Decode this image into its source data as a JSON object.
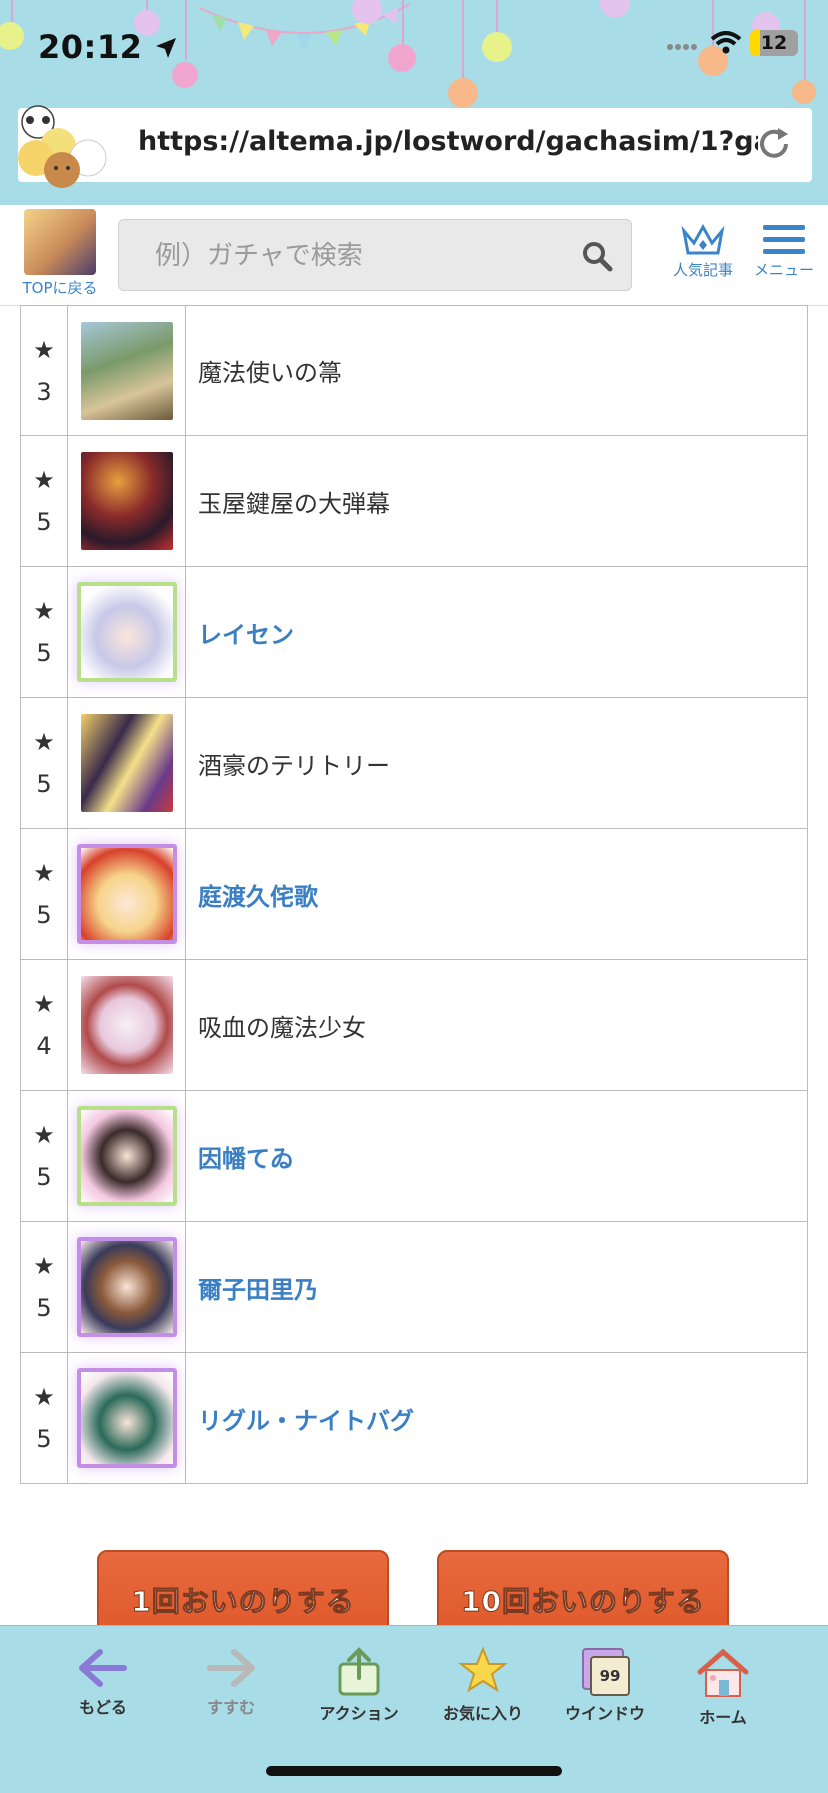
{
  "status_bar": {
    "time": "20:12",
    "battery": "12"
  },
  "browser": {
    "url": "https://altema.jp/lostword/gachasim/1?gac..."
  },
  "site_header": {
    "top_label": "TOPに戻る",
    "search_placeholder": "例）ガチャで検索",
    "popular_label": "人気記事",
    "menu_label": "メニュー"
  },
  "rows": [
    {
      "stars": "★",
      "rarity": "3",
      "name": "魔法使いの箒",
      "link": false
    },
    {
      "stars": "★",
      "rarity": "5",
      "name": "玉屋鍵屋の大弾幕",
      "link": false
    },
    {
      "stars": "★",
      "rarity": "5",
      "name": "レイセン",
      "link": true
    },
    {
      "stars": "★",
      "rarity": "5",
      "name": "酒豪のテリトリー",
      "link": false
    },
    {
      "stars": "★",
      "rarity": "5",
      "name": "庭渡久侘歌",
      "link": true
    },
    {
      "stars": "★",
      "rarity": "4",
      "name": "吸血の魔法少女",
      "link": false
    },
    {
      "stars": "★",
      "rarity": "5",
      "name": "因幡てゐ",
      "link": true
    },
    {
      "stars": "★",
      "rarity": "5",
      "name": "爾子田里乃",
      "link": true
    },
    {
      "stars": "★",
      "rarity": "5",
      "name": "リグル・ナイトバグ",
      "link": true
    }
  ],
  "gacha_buttons": {
    "single": "1回おいのりする",
    "ten": "10回おいのりする"
  },
  "toolbar": {
    "back": "もどる",
    "forward": "すすむ",
    "action": "アクション",
    "favorites": "お気に入り",
    "window": "ウインドウ",
    "window_count": "99",
    "home": "ホーム"
  },
  "colors": {
    "sky": "#a8dce6",
    "link": "#3a7fc4",
    "button": "#e05a2c"
  }
}
